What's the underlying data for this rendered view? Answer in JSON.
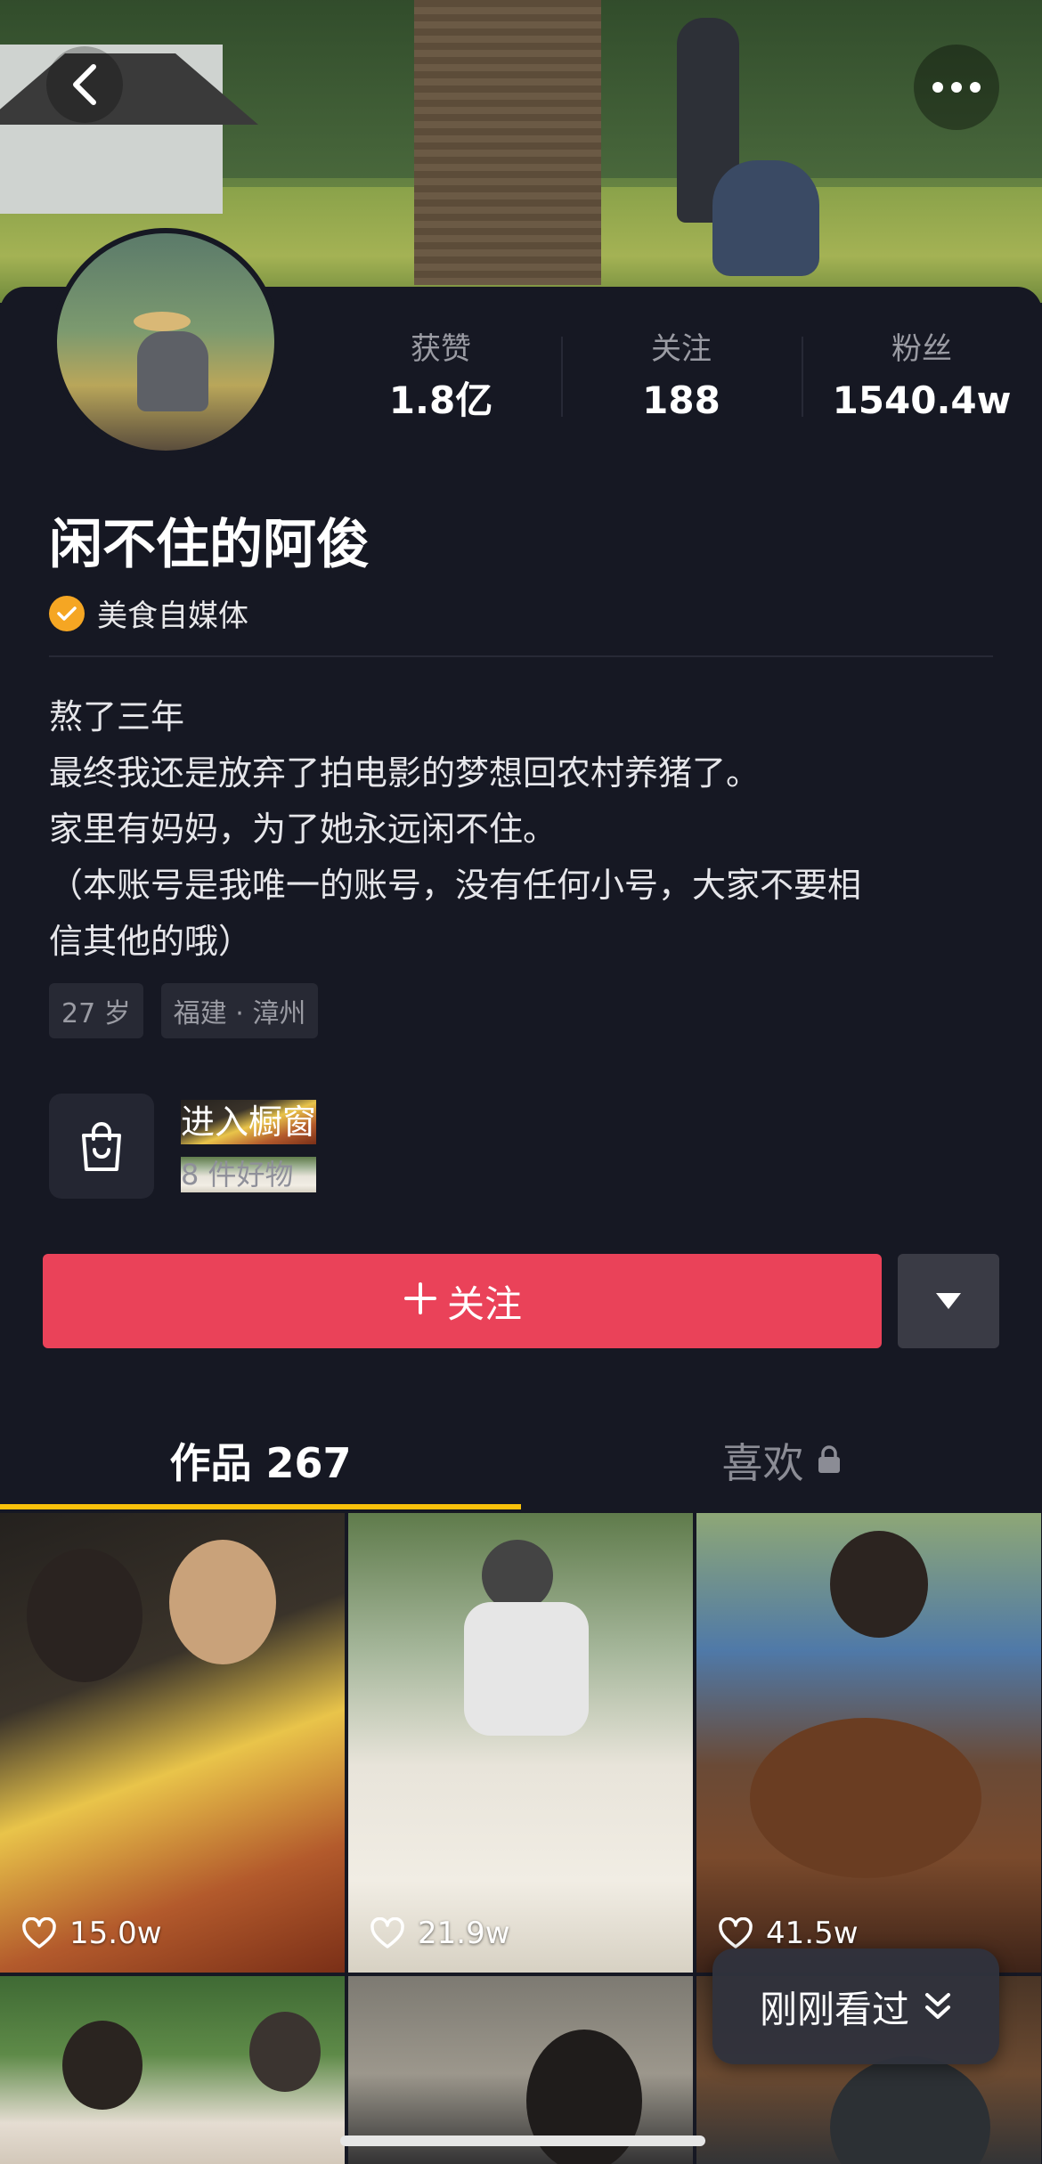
{
  "header": {
    "back_icon": "chevron-left-icon",
    "more_icon": "ellipsis-icon"
  },
  "profile": {
    "nickname": "闲不住的阿俊",
    "verification": "美食自媒体",
    "stats": [
      {
        "label": "获赞",
        "value": "1.8亿"
      },
      {
        "label": "关注",
        "value": "188"
      },
      {
        "label": "粉丝",
        "value": "1540.4w"
      }
    ],
    "bio_lines": [
      "熬了三年",
      "最终我还是放弃了拍电影的梦想回农村养猪了。",
      "家里有妈妈，为了她永远闲不住。",
      "（本账号是我唯一的账号，没有任何小号，大家不要相",
      "信其他的哦）"
    ],
    "tags": [
      "27 岁",
      "福建 · 漳州"
    ]
  },
  "shop": {
    "title": "进入橱窗",
    "subtitle": "8 件好物"
  },
  "actions": {
    "follow_label": "关注",
    "follow_color": "#ea4259"
  },
  "tabs": [
    {
      "label": "作品 267",
      "active": true
    },
    {
      "label": "喜欢",
      "active": false,
      "locked": true
    }
  ],
  "videos": [
    {
      "likes": "15.0w"
    },
    {
      "likes": "21.9w"
    },
    {
      "likes": "41.5w"
    },
    {
      "likes": ""
    },
    {
      "likes": ""
    },
    {
      "likes": ""
    }
  ],
  "floating": {
    "recent_label": "刚刚看过"
  },
  "colors": {
    "background": "#161823",
    "accent_underline": "#f9c10b",
    "verify_badge": "#f5a623"
  }
}
